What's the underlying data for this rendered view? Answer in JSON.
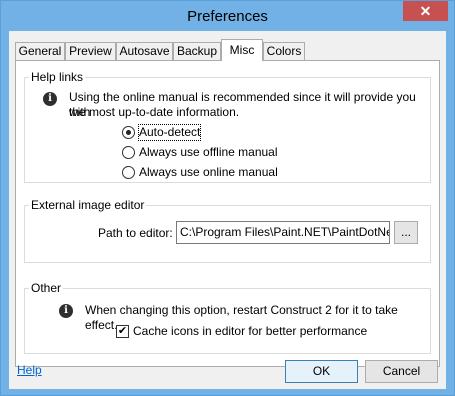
{
  "window": {
    "title": "Preferences",
    "close_glyph": "✕"
  },
  "tabs": [
    {
      "label": "General"
    },
    {
      "label": "Preview"
    },
    {
      "label": "Autosave"
    },
    {
      "label": "Backup"
    },
    {
      "label": "Misc",
      "active": true
    },
    {
      "label": "Colors"
    }
  ],
  "help_links": {
    "label": "Help links",
    "info_line1": "Using the online manual is recommended since it will provide you with",
    "info_line2": "the most up-to-date information.",
    "options": [
      {
        "label": "Auto-detect",
        "checked": true
      },
      {
        "label": "Always use offline manual",
        "checked": false
      },
      {
        "label": "Always use online manual",
        "checked": false
      }
    ]
  },
  "external_editor": {
    "label": "External image editor",
    "path_label": "Path to editor:",
    "path_value": "C:\\Program Files\\Paint.NET\\PaintDotNet.exe",
    "browse_label": "..."
  },
  "other": {
    "label": "Other",
    "info": "When changing this option, restart Construct 2 for it to take effect.",
    "cache_label": "Cache icons in editor for better performance",
    "cache_checked": true
  },
  "footer": {
    "help_label": "Help",
    "ok_label": "OK",
    "cancel_label": "Cancel"
  },
  "icons": {
    "info": "info-icon",
    "close": "close-icon"
  }
}
